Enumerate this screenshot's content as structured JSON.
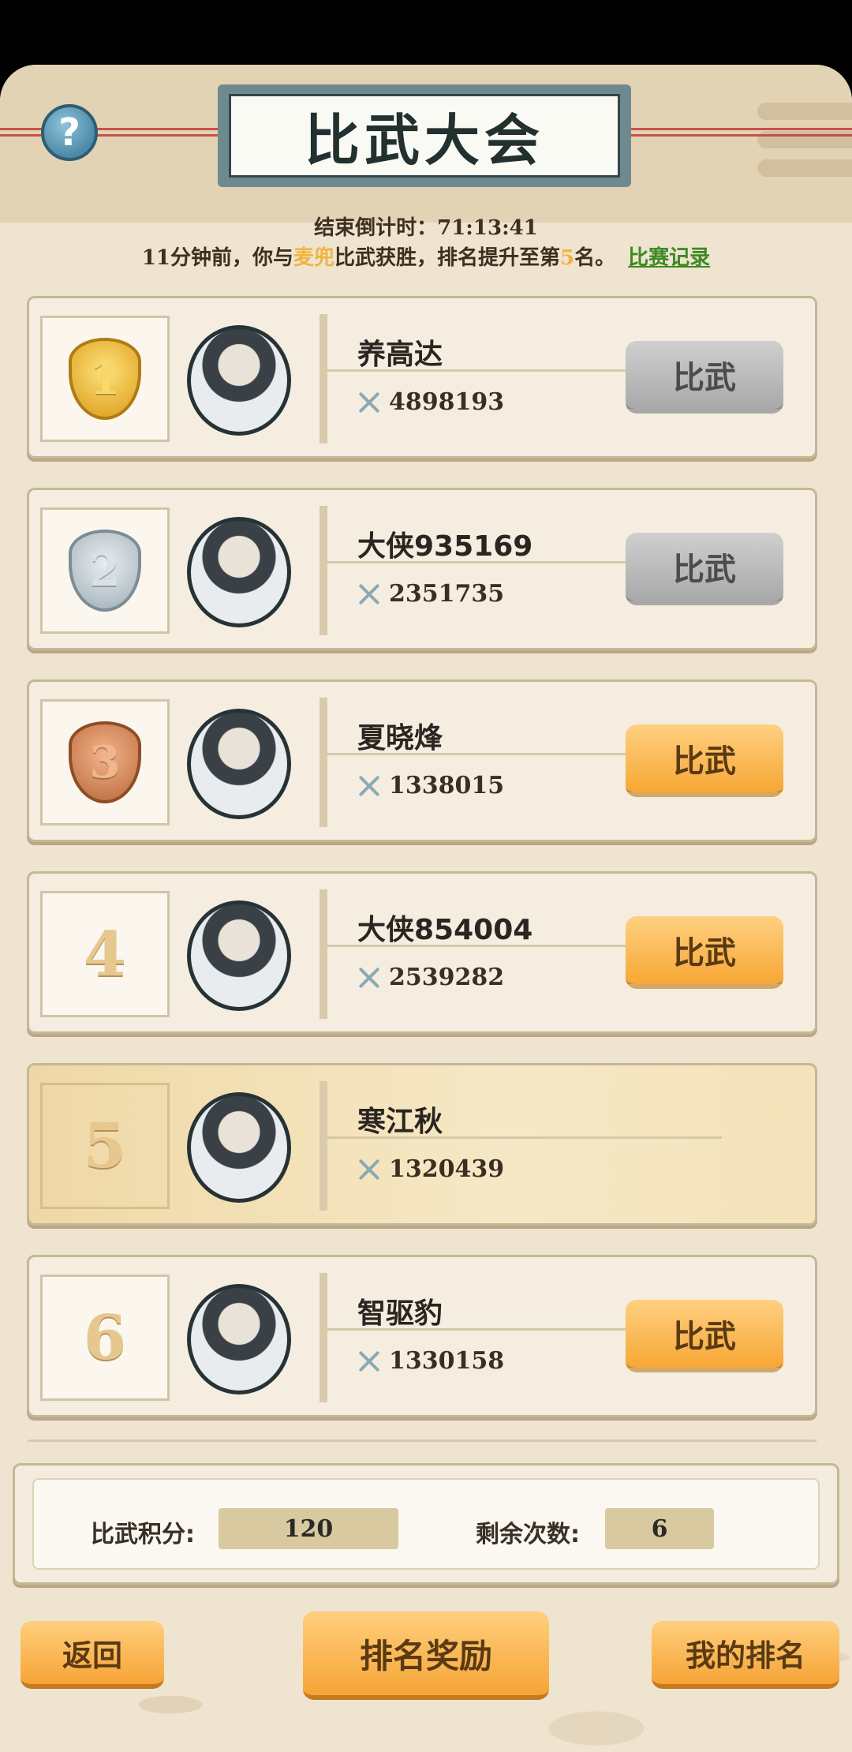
{
  "header": {
    "title": "比武大会",
    "help_symbol": "?",
    "countdown_label": "结束倒计时：",
    "countdown_value": "71:13:41",
    "news": {
      "prefix": "11分钟前，你与",
      "opponent": "麦兜",
      "middle": "比武获胜，排名提升至第",
      "rank": "5",
      "suffix": "名。",
      "record_link": "比赛记录"
    }
  },
  "rows": [
    {
      "rank": "1",
      "medal": "gold",
      "name": "养高达",
      "power": "4898193",
      "button": "比武",
      "button_style": "grey"
    },
    {
      "rank": "2",
      "medal": "silver",
      "name": "大侠935169",
      "power": "2351735",
      "button": "比武",
      "button_style": "grey"
    },
    {
      "rank": "3",
      "medal": "bronze",
      "name": "夏晓烽",
      "power": "1338015",
      "button": "比武",
      "button_style": "orange"
    },
    {
      "rank": "4",
      "medal": "none",
      "name": "大侠854004",
      "power": "2539282",
      "button": "比武",
      "button_style": "orange"
    },
    {
      "rank": "5",
      "medal": "none",
      "name": "寒江秋",
      "power": "1320439",
      "button": "",
      "button_style": "none",
      "is_me": true
    },
    {
      "rank": "6",
      "medal": "none",
      "name": "智驱豹",
      "power": "1330158",
      "button": "比武",
      "button_style": "orange"
    }
  ],
  "stats": {
    "score_label": "比武积分:",
    "score_value": "120",
    "remaining_label": "剩余次数:",
    "remaining_value": "6"
  },
  "footer": {
    "back_label": "返回",
    "rewards_label": "排名奖励",
    "my_rank_label": "我的排名"
  },
  "icons": {
    "help": "question-icon",
    "power": "crossed-swords-icon",
    "medal": "rank-medal-icon",
    "avatar": "character-portrait"
  },
  "colors": {
    "highlight": "#f2b340",
    "link": "#3c8a23",
    "orange_button": "#f7a735",
    "grey_button": "#a9a9a9",
    "background": "#efe4cf"
  }
}
